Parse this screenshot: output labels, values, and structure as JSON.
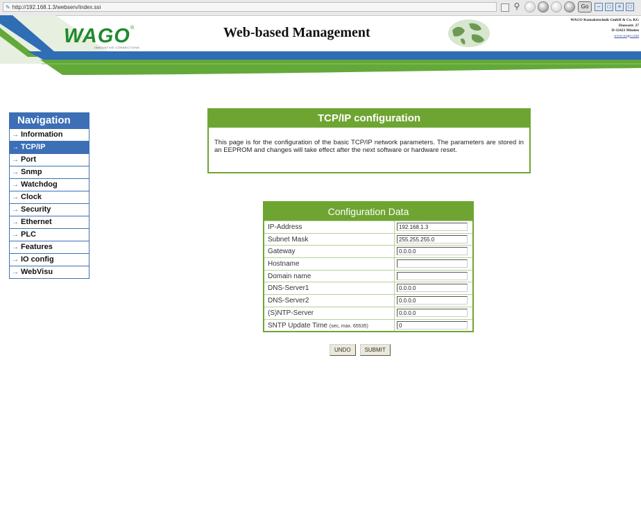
{
  "browser": {
    "url": "http://192.168.1.3/webserv/index.ssi",
    "go_label": "Go"
  },
  "header": {
    "logo_text": "WAGO",
    "logo_tagline": "INNOVATIVE CONNECTIONS",
    "title": "Web-based Management",
    "company_lines": [
      "WAGO Kontakttechnik GmbH & Co. KG",
      "Hansastr. 27",
      "D-32423 Minden"
    ],
    "company_url": "www.wago.com"
  },
  "nav": {
    "title": "Navigation",
    "items": [
      {
        "label": "Information",
        "active": false
      },
      {
        "label": "TCP/IP",
        "active": true
      },
      {
        "label": "Port",
        "active": false
      },
      {
        "label": "Snmp",
        "active": false
      },
      {
        "label": "Watchdog",
        "active": false
      },
      {
        "label": "Clock",
        "active": false
      },
      {
        "label": "Security",
        "active": false
      },
      {
        "label": "Ethernet",
        "active": false
      },
      {
        "label": "PLC",
        "active": false
      },
      {
        "label": "Features",
        "active": false
      },
      {
        "label": "IO config",
        "active": false
      },
      {
        "label": "WebVisu",
        "active": false
      }
    ]
  },
  "info": {
    "title": "TCP/IP configuration",
    "text": "This page is for the configuration of the basic TCP/IP network parameters. The parameters are stored in an EEPROM and changes will take effect after the next software or hardware reset."
  },
  "config": {
    "title": "Configuration Data",
    "rows": [
      {
        "label": "IP-Address",
        "note": "",
        "value": "192.168.1.3"
      },
      {
        "label": "Subnet Mask",
        "note": "",
        "value": "255.255.255.0"
      },
      {
        "label": "Gateway",
        "note": "",
        "value": "0.0.0.0"
      },
      {
        "label": "Hostname",
        "note": "",
        "value": ""
      },
      {
        "label": "Domain name",
        "note": "",
        "value": ""
      },
      {
        "label": "DNS-Server1",
        "note": "",
        "value": "0.0.0.0"
      },
      {
        "label": "DNS-Server2",
        "note": "",
        "value": "0.0.0.0"
      },
      {
        "label": "(S)NTP-Server",
        "note": "",
        "value": "0.0.0.0"
      },
      {
        "label": "SNTP Update Time ",
        "note": "(sec, max. 65535)",
        "value": "0"
      }
    ],
    "undo_label": "UNDO",
    "submit_label": "SUBMIT"
  },
  "colors": {
    "nav_blue": "#3c6fb6",
    "wago_green": "#6ea532",
    "band_blue": "#2f6db5",
    "band_green": "#63a93a"
  }
}
